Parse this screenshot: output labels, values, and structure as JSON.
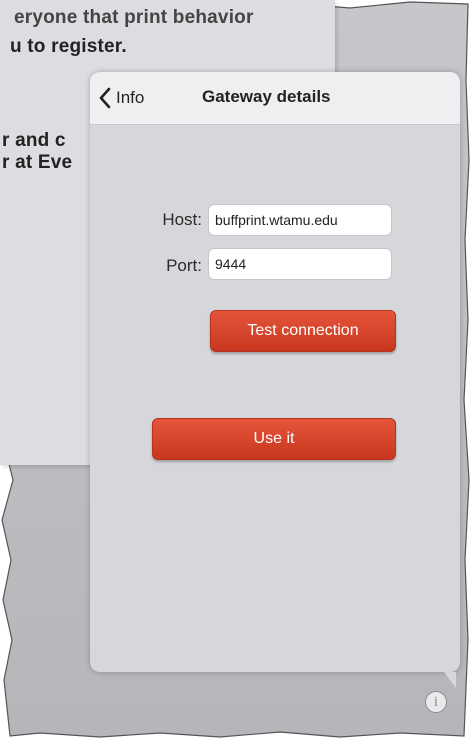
{
  "background": {
    "line1": "eryone that print behavior",
    "line2": "u to register.",
    "line3": "r and c",
    "line4": "r at Eve"
  },
  "popover": {
    "back_label": "Info",
    "title": "Gateway details",
    "host_label": "Host:",
    "host_value": "buffprint.wtamu.edu",
    "port_label": "Port:",
    "port_value": "9444",
    "test_button": "Test connection",
    "use_button": "Use it"
  },
  "info_icon": "info-icon",
  "colors": {
    "accent_red": "#d94a2f",
    "popover_bg": "#d6d7da",
    "header_bg": "#eeeff1"
  }
}
